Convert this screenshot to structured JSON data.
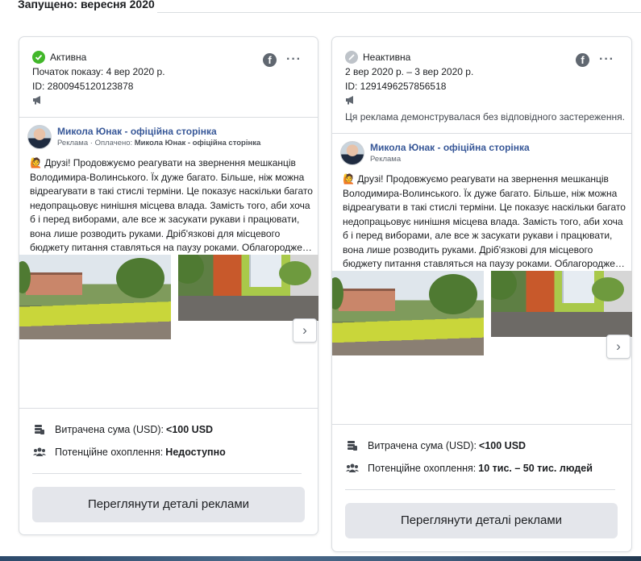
{
  "header": {
    "title": "Запущено: вересня 2020"
  },
  "cards": [
    {
      "status": "Активна",
      "dates": "Початок показу: 4 вер 2020 р.",
      "id": "ID: 2800945120123878",
      "page_name": "Микола Юнак - офіційна сторінка",
      "sponsored_label": "Реклама",
      "paid_by_label": "Оплачено:",
      "paid_by": "Микола Юнак - офіційна сторінка",
      "text_lines": [
        "🙋 Друзі! Продовжуємо реагувати на звернення мешканців",
        "Володимира-Волинського. Їх дуже багато. Більше, ніж можна",
        "відреагувати в такі стислі терміни. Це показує наскільки багато",
        "недопрацьовує нинішня місцева влада. Замість того, аби хоча",
        "б і перед виборами, але все ж засукати рукави і працювати,",
        "вона лише розводить руками. Дріб'язкові для місцевого",
        "бюджету питання ставляться на паузу роками. Облагородже…"
      ],
      "spend_label": "Витрачена сума (USD):",
      "spend_value": "<100 USD",
      "reach_label": "Потенційне охоплення:",
      "reach_value": "Недоступно",
      "button_label": "Переглянути деталі реклами"
    },
    {
      "status": "Неактивна",
      "dates": "2 вер 2020 р. – 3 вер 2020 р.",
      "id": "ID: 1291496257856518",
      "disclaimer": "Ця реклама демонструвалася без відповідного застереження.",
      "page_name": "Микола Юнак - офіційна сторінка",
      "sponsored_label": "Реклама",
      "text_lines": [
        "🙋 Друзі! Продовжуємо реагувати на звернення мешканців",
        "Володимира-Волинського. Їх дуже багато. Більше, ніж можна",
        "відреагувати в такі стислі терміни. Це показує наскільки багато",
        "недопрацьовує нинішня місцева влада. Замість того, аби хоча",
        "б і перед виборами, але все ж засукати рукави і працювати,",
        "вона лише розводить руками. Дріб'язкові для місцевого",
        "бюджету питання ставляться на паузу роками. Облагородже…"
      ],
      "spend_label": "Витрачена сума (USD):",
      "spend_value": "<100 USD",
      "reach_label": "Потенційне охоплення:",
      "reach_value": "10 тис. – 50 тис. людей",
      "button_label": "Переглянути деталі реклами"
    }
  ],
  "icons": {
    "active": "check-circle-icon",
    "inactive": "slash-circle-icon",
    "facebook": "facebook-icon",
    "more": "more-dots-icon",
    "megaphone": "megaphone-icon",
    "money": "money-stack-icon",
    "people": "people-icon",
    "next": "chevron-right-icon"
  },
  "colors": {
    "active": "#42b72a",
    "inactive": "#bec3c9",
    "link": "#385898",
    "button": "#e4e6eb"
  }
}
